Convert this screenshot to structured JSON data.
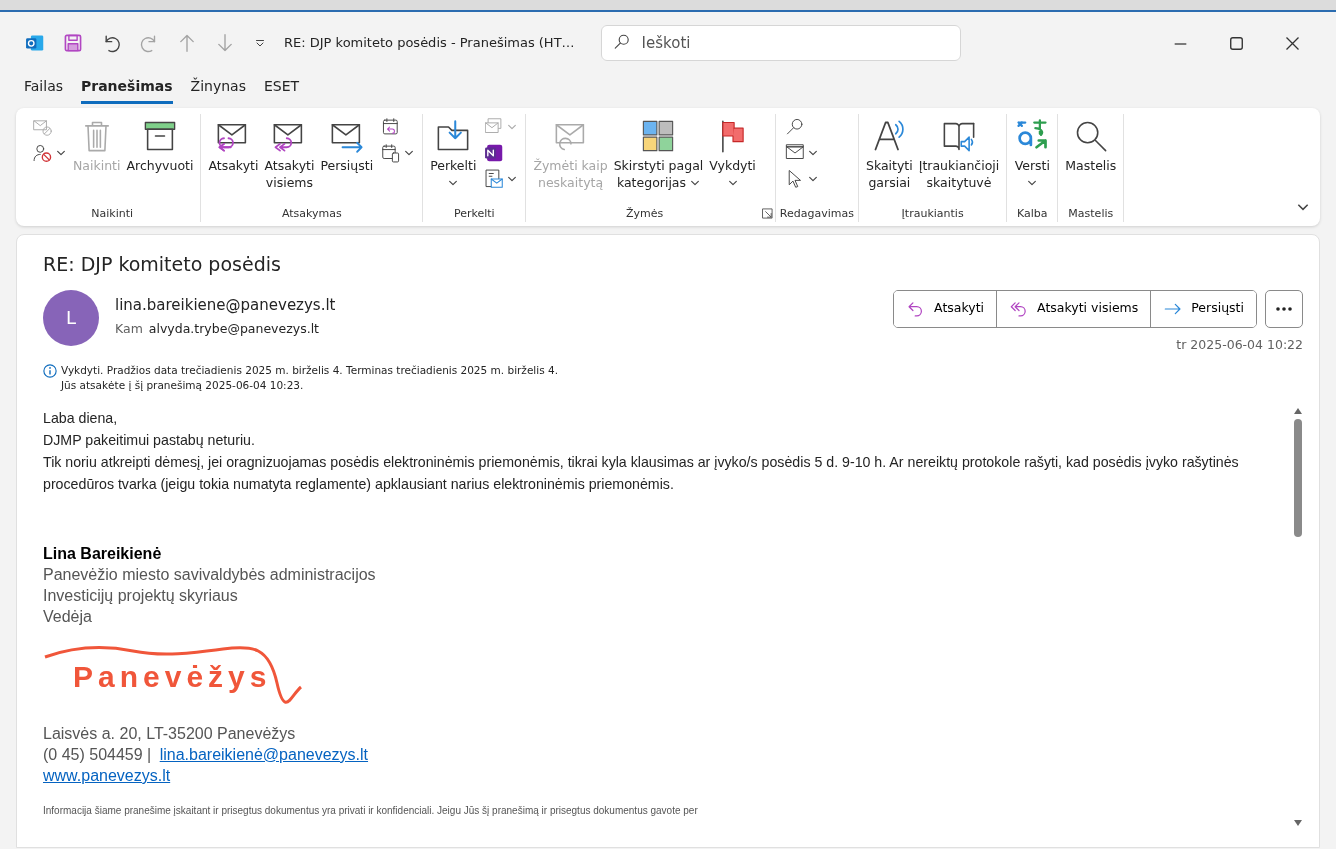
{
  "window": {
    "title": "RE: DJP komiteto posėdis  -  Pranešimas (HT…"
  },
  "quick_access": [
    {
      "kind": "app",
      "disabled": false
    },
    {
      "kind": "save",
      "disabled": false
    },
    {
      "kind": "undo",
      "disabled": false
    },
    {
      "kind": "redo",
      "disabled": true
    },
    {
      "kind": "up",
      "disabled": true
    },
    {
      "kind": "down",
      "disabled": true
    },
    {
      "kind": "customize",
      "disabled": false
    }
  ],
  "search": {
    "placeholder": "Ieškoti"
  },
  "menu_tabs": [
    {
      "label": "Failas",
      "selected": false
    },
    {
      "label": "Pranešimas",
      "selected": true
    },
    {
      "label": "Žinynas",
      "selected": false
    },
    {
      "label": "ESET",
      "selected": false
    }
  ],
  "ribbon": {
    "groups": [
      {
        "label": "Naikinti",
        "items": [
          {
            "kind": "stack",
            "icons": [
              {
                "kind": "ignore",
                "disabled": true,
                "dropdown": false
              },
              {
                "kind": "junk",
                "disabled": false,
                "dropdown": true
              }
            ]
          },
          {
            "kind": "trash",
            "label": "Naikinti",
            "disabled": true,
            "dropdown": false
          },
          {
            "kind": "archive",
            "label": "Archyvuoti",
            "disabled": false,
            "dropdown": false
          }
        ]
      },
      {
        "label": "Atsakymas",
        "items": [
          {
            "kind": "reply",
            "label": "Atsakyti",
            "disabled": false,
            "dropdown": false
          },
          {
            "kind": "reply_all",
            "label": "Atsakyti",
            "label_2": "visiems",
            "disabled": false,
            "dropdown": false
          },
          {
            "kind": "forward",
            "label": "Persiųsti",
            "disabled": false,
            "dropdown": false
          },
          {
            "kind": "stack",
            "icons": [
              {
                "kind": "meeting_reply",
                "disabled": false,
                "dropdown": false
              },
              {
                "kind": "calendar_device",
                "disabled": false,
                "dropdown": true
              }
            ]
          }
        ]
      },
      {
        "label": "Perkelti",
        "items": [
          {
            "kind": "move",
            "label": "Perkelti",
            "disabled": false,
            "dropdown": true
          },
          {
            "kind": "stack",
            "icons": [
              {
                "kind": "move_small",
                "disabled": true,
                "dropdown": true
              },
              {
                "kind": "onenote",
                "disabled": false,
                "dropdown": false
              },
              {
                "kind": "rules",
                "disabled": false,
                "dropdown": true
              }
            ]
          }
        ]
      },
      {
        "label": "Žymės",
        "launcher": true,
        "items": [
          {
            "kind": "mark_unread",
            "label": "Žymėti kaip",
            "label_2": "neskaitytą",
            "disabled": true,
            "dropdown": false
          },
          {
            "kind": "categorize",
            "label": "Skirstyti pagal",
            "label_2": "kategorijas",
            "disabled": false,
            "dropdown": true
          },
          {
            "kind": "flag",
            "label": "Vykdyti",
            "disabled": false,
            "dropdown": true
          }
        ]
      },
      {
        "label": "Redagavimas",
        "items": [
          {
            "kind": "stack",
            "icons": [
              {
                "kind": "find",
                "disabled": false,
                "dropdown": false
              },
              {
                "kind": "select_env",
                "disabled": false,
                "dropdown": true
              },
              {
                "kind": "cursor",
                "disabled": false,
                "dropdown": true
              }
            ]
          }
        ]
      },
      {
        "label": "Įtraukiantis",
        "items": [
          {
            "kind": "read_aloud",
            "label": "Skaityti",
            "label_2": "garsiai",
            "disabled": false,
            "dropdown": false
          },
          {
            "kind": "immersive",
            "label": "Įtraukiančioji",
            "label_2": "skaitytuvė",
            "disabled": false,
            "dropdown": false
          }
        ]
      },
      {
        "label": "Kalba",
        "items": [
          {
            "kind": "translate",
            "label": "Versti",
            "disabled": false,
            "dropdown": true
          }
        ]
      },
      {
        "label": "Mastelis",
        "items": [
          {
            "kind": "zoom",
            "label": "Mastelis",
            "disabled": false,
            "dropdown": false
          }
        ]
      }
    ]
  },
  "message": {
    "subject": "RE: DJP komiteto posėdis",
    "avatar_initial": "L",
    "sender": "lina.bareikiene@panevezys.lt",
    "to_label": "Kam",
    "to": "alvyda.trybe@panevezys.lt",
    "info_lines": [
      "Vykdyti.  Pradžios data trečiadienis 2025 m. birželis 4.  Terminas trečiadienis 2025 m. birželis 4.",
      "Jūs atsakėte į šį pranešimą 2025-06-04 10:23."
    ],
    "actions": [
      {
        "kind": "reply",
        "label": "Atsakyti"
      },
      {
        "kind": "reply_all",
        "label": "Atsakyti visiems"
      },
      {
        "kind": "forward",
        "label": "Persiųsti"
      }
    ],
    "date": "tr 2025-06-04 10:22",
    "body": [
      "Laba diena,",
      "DJMP pakeitimui pastabų neturiu.",
      "Tik noriu atkreipti dėmesį, jei oragnizuojamas posėdis elektroninėmis priemonėmis, tikrai kyla klausimas ar įvyko/s posėdis 5 d. 9-10 h. Ar nereiktų protokole rašyti, kad posėdis įvyko rašytinės procedūros tvarka (jeigu tokia numatyta reglamente) apklausiant narius elektroninėmis priemonėmis."
    ],
    "signature": {
      "name": "Lina Bareikienė",
      "lines": [
        "Panevėžio miesto savivaldybės administracijos",
        "Investicijų projektų skyriaus",
        "Vedėja"
      ],
      "logo_text": "Panevėžys",
      "address": "Laisvės a. 20, LT-35200 Panevėžys",
      "phone": "(0 45) 504459 |",
      "email": "lina.bareikienė@panevezys.lt",
      "website": "www.panevezys.lt",
      "disclaimer": "Informacija šiame pranešime įskaitant ir prisegtus dokumentus yra privati ir konfidenciali. Jeigu Jūs šį pranešimą ir prisegtus dokumentus gavote per"
    }
  }
}
